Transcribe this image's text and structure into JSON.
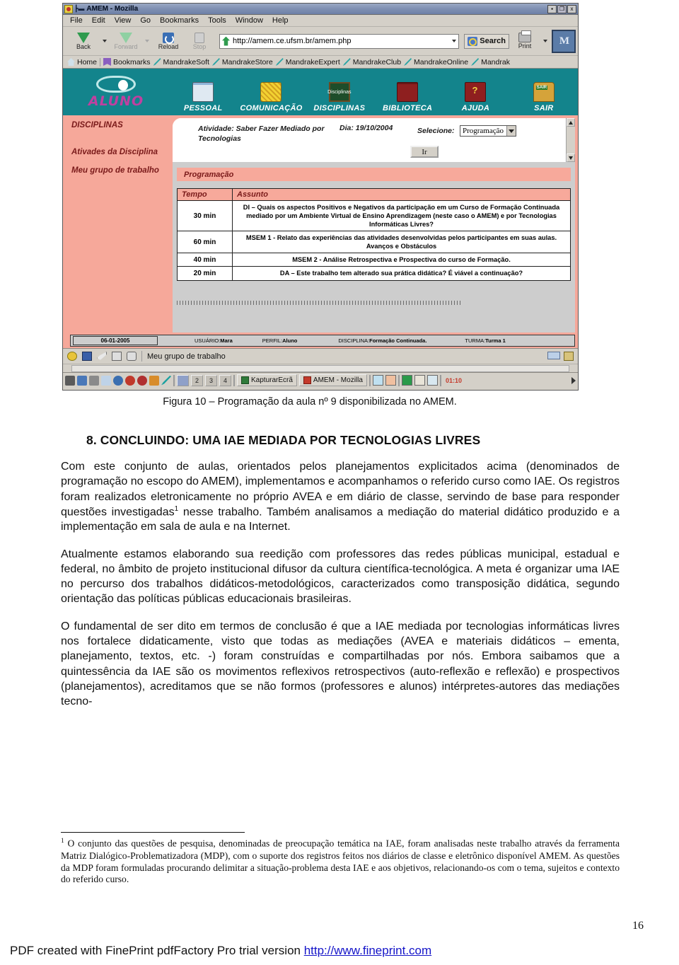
{
  "browser": {
    "window_title": "AMEM - Mozilla",
    "window_buttons": {
      "minimize": "▪",
      "maximize": "❐",
      "close": "x"
    },
    "menu": [
      "File",
      "Edit",
      "View",
      "Go",
      "Bookmarks",
      "Tools",
      "Window",
      "Help"
    ],
    "toolbar": {
      "back": "Back",
      "forward": "Forward",
      "reload": "Reload",
      "stop": "Stop",
      "url": "http://amem.ce.ufsm.br/amem.php",
      "search": "Search",
      "print": "Print"
    },
    "bookmarks_bar": [
      "Home",
      "Bookmarks",
      "MandrakeSoft",
      "MandrakeStore",
      "MandrakeExpert",
      "MandrakeClub",
      "MandrakeOnline",
      "Mandrak"
    ]
  },
  "amem": {
    "logo_text": "ALUNO",
    "nav": [
      {
        "label": "PESSOAL",
        "icon": "person-documents-icon"
      },
      {
        "label": "COMUNICAÇÃO",
        "icon": "communication-icon"
      },
      {
        "label": "DISCIPLINAS",
        "icon": "chalkboard-icon",
        "icon_text": "Disciplinas"
      },
      {
        "label": "BIBLIOTECA",
        "icon": "books-icon"
      },
      {
        "label": "AJUDA",
        "icon": "help-book-icon"
      },
      {
        "label": "SAIR",
        "icon": "exit-door-icon",
        "icon_text": "SAIR"
      }
    ],
    "sidebar": {
      "section_title": "DISCIPLINAS",
      "items": [
        "Ativades da Disciplina",
        "Meu grupo de trabalho"
      ]
    },
    "activity": {
      "atividade_label": "Atividade: Saber Fazer Mediado por Tecnologias",
      "dia_label": "Dia: 19/10/2004",
      "selecione_label": "Selecione:",
      "select_value": "Programação",
      "go_button": "Ir"
    },
    "program_band": "Programação",
    "table": {
      "headers": [
        "Tempo",
        "Assunto"
      ],
      "rows": [
        {
          "tempo": "30 min",
          "assunto": "DI – Quais os aspectos Positivos e Negativos da participação em um Curso de Formação Continuada mediado por um Ambiente Virtual de Ensino Aprendizagem (neste caso o AMEM) e por Tecnologias Informáticas Livres?"
        },
        {
          "tempo": "60 min",
          "assunto": "MSEM 1 - Relato das experiências das atividades desenvolvidas pelos participantes em suas aulas. Avanços e Obstáculos"
        },
        {
          "tempo": "40 min",
          "assunto": "MSEM 2 - Análise Retrospectiva e Prospectiva do curso de Formação."
        },
        {
          "tempo": "20 min",
          "assunto": "DA – Este trabalho tem alterado sua prática didática? É viável a continuação?"
        }
      ]
    },
    "status": {
      "date": "06-01-2005",
      "usuario_label": "USUÁRIO:",
      "usuario_value": "Mara",
      "perfil_label": "PERFIL:",
      "perfil_value": "Aluno",
      "disciplina_label": "DISCIPLINA:",
      "disciplina_value": "Formação Continuada.",
      "turma_label": "TURMA:",
      "turma_value": "Turma 1"
    }
  },
  "browser_status": {
    "text": "Meu grupo de trabalho"
  },
  "taskbar": {
    "desktops": [
      "",
      "2",
      "3",
      "4"
    ],
    "tasks": [
      "KapturarEcrã",
      "AMEM - Mozilla"
    ],
    "clock": "01:10"
  },
  "document": {
    "figure_caption": "Figura 10 – Programação da aula nº 9 disponibilizada no AMEM.",
    "heading": "8. CONCLUINDO: UMA IAE MEDIADA POR TECNOLOGIAS LIVRES",
    "para1_a": "Com este conjunto de aulas, orientados pelos planejamentos explicitados acima (denominados de programação no escopo do AMEM), implementamos e acompanhamos o referido curso como IAE. Os registros foram realizados eletronicamente no próprio AVEA e em diário de classe, servindo de base para responder questões investigadas",
    "para1_sup": "1",
    "para1_b": " nesse trabalho. Também analisamos a mediação do material didático produzido e a implementação em sala de aula e na Internet.",
    "para2": "Atualmente estamos elaborando sua reedição com professores das redes públicas municipal, estadual e federal, no âmbito de projeto institucional difusor da cultura científica-tecnológica. A meta é organizar uma IAE no percurso dos trabalhos didáticos-metodológicos, caracterizados como transposição didática, segundo orientação das políticas públicas educacionais brasileiras.",
    "para3": "O fundamental de ser dito em termos de conclusão é que a IAE mediada por tecnologias informáticas livres nos fortalece didaticamente, visto que todas as mediações (AVEA e materiais didáticos – ementa, planejamento, textos, etc. -) foram construídas e compartilhadas por nós.  Embora saibamos que a quintessência da IAE são os movimentos reflexivos retrospectivos (auto-reflexão e reflexão) e prospectivos (planejamentos), acreditamos que se não formos (professores e alunos) intérpretes-autores das mediações tecno-",
    "footnote_number": "1",
    "footnote_text": "O conjunto das questões de pesquisa, denominadas de preocupação temática na IAE, foram analisadas neste trabalho através da ferramenta Matriz Dialógico-Problematizadora (MDP), com o suporte dos registros feitos nos diários de classe e eletrônico disponível AMEM. As questões da MDP foram formuladas procurando delimitar a situação-problema desta IAE e aos objetivos, relacionando-os com o tema, sujeitos e contexto do referido curso.",
    "page_number": "16",
    "fineprint_text": "PDF created with FinePrint pdfFactory Pro trial version ",
    "fineprint_link": "http://www.fineprint.com"
  },
  "colors": {
    "teal": "#13848c",
    "pink": "#f6a89a",
    "pink_band": "#f7a99b",
    "chrome_gray": "#d4d0c8",
    "link_blue": "#1414c8",
    "logo_magenta": "#c040a0"
  }
}
